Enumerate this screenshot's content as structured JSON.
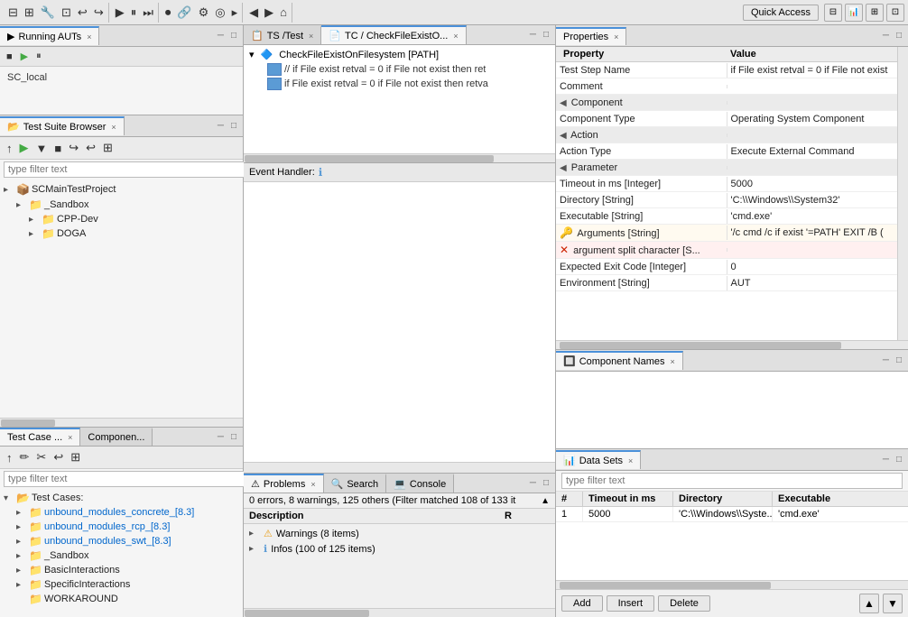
{
  "toolbar": {
    "quick_access_label": "Quick Access",
    "icons": [
      "⬛",
      "⬛",
      "⬛",
      "⬛"
    ]
  },
  "running_auts": {
    "tab_label": "Running AUTs",
    "sc_item": "SC_local",
    "run_icon": "▶",
    "min_btn": "─",
    "max_btn": "□"
  },
  "test_suite_browser": {
    "tab_label": "Test Suite Browser",
    "close_icon": "×",
    "filter_placeholder": "type filter text",
    "toolbar_icons": [
      "↑",
      "▶",
      "▼",
      "■",
      "↪",
      "↩"
    ],
    "tree": {
      "root": {
        "label": "SCMainTestProject",
        "icon": "📁",
        "children": [
          {
            "label": "_Sandbox",
            "icon": "📁",
            "children": [
              {
                "label": "CPP-Dev",
                "icon": "📁",
                "children": []
              },
              {
                "label": "DOGA",
                "icon": "📁",
                "children": []
              }
            ]
          }
        ]
      }
    }
  },
  "test_case_panel": {
    "tab1_label": "Test Case ...",
    "tab1_close": "×",
    "tab2_label": "Componen...",
    "filter_placeholder": "type filter text",
    "toolbar_icons": [
      "↑",
      "✏",
      "✂",
      "↩"
    ],
    "tree_items": [
      {
        "label": "Test Cases:",
        "icon": "📁",
        "type": "root"
      },
      {
        "label": "unbound_modules_concrete_[8.3]",
        "icon": "📁",
        "type": "folder",
        "indent": 1
      },
      {
        "label": "unbound_modules_rcp_[8.3]",
        "icon": "📁",
        "type": "folder",
        "indent": 1
      },
      {
        "label": "unbound_modules_swt_[8.3]",
        "icon": "📁",
        "type": "folder",
        "indent": 1
      },
      {
        "label": "_Sandbox",
        "icon": "📁",
        "type": "folder",
        "indent": 1
      },
      {
        "label": "BasicInteractions",
        "icon": "📁",
        "type": "folder",
        "indent": 1
      },
      {
        "label": "SpecificInteractions",
        "icon": "📁",
        "type": "folder",
        "indent": 1
      },
      {
        "label": "WORKAROUND",
        "icon": "📁",
        "type": "folder",
        "indent": 1
      }
    ]
  },
  "ts_panel": {
    "tab1_label": "TS /Test",
    "tab1_close": "×",
    "tab2_label": "TC / CheckFileExistO...",
    "tab2_close": "×",
    "close_icon": "×",
    "ts_tree": {
      "root_label": "CheckFileExistOnFilesystem [PATH]",
      "root_icon": "🔷",
      "steps": [
        {
          "text": "// if File exist retval = 0 if File not exist then ret",
          "active": true
        },
        {
          "text": "if File exist retval = 0 if File not exist then retva",
          "active": true
        }
      ]
    }
  },
  "event_handler": {
    "label": "Event Handler:",
    "icon": "ℹ"
  },
  "problems_panel": {
    "tab1_label": "Problems",
    "tab1_close": "×",
    "tab2_label": "Search",
    "tab3_label": "Console",
    "filter_text": "0 errors, 8 warnings, 125 others (Filter matched 108 of 133 it",
    "col_description": "Description",
    "col_resource": "R",
    "rows": [
      {
        "icon": "warn",
        "label": "Warnings (8 items)",
        "expand": false
      },
      {
        "icon": "info",
        "label": "Infos (100 of 125 items)",
        "expand": false
      }
    ]
  },
  "properties_panel": {
    "tab_label": "Properties",
    "close_icon": "×",
    "min_btn": "─",
    "max_btn": "□",
    "col_property": "Property",
    "col_value": "Value",
    "rows": [
      {
        "type": "section",
        "name": "Test Step Name",
        "value": "if File exist retval = 0 if File not exist"
      },
      {
        "type": "normal",
        "name": "Comment",
        "value": ""
      },
      {
        "type": "section-header",
        "name": "Component",
        "value": ""
      },
      {
        "type": "normal",
        "name": "Component Type",
        "value": "Operating System Component"
      },
      {
        "type": "section-header",
        "name": "Action",
        "value": ""
      },
      {
        "type": "normal",
        "name": "Action Type",
        "value": "Execute External Command"
      },
      {
        "type": "section-header",
        "name": "Parameter",
        "value": ""
      },
      {
        "type": "normal",
        "name": "Timeout in ms [Integer]",
        "value": "5000"
      },
      {
        "type": "normal",
        "name": "Directory [String]",
        "value": "'C:\\\\Windows\\\\System32'"
      },
      {
        "type": "normal",
        "name": "Executable [String]",
        "value": "'cmd.exe'"
      },
      {
        "type": "special",
        "name": "Arguments [String]",
        "value": "'/c cmd /c if exist '=PATH' EXIT /B (",
        "icon": "arg"
      },
      {
        "type": "err",
        "name": "argument split character [S...",
        "value": "",
        "icon": "err"
      },
      {
        "type": "normal",
        "name": "Expected Exit Code [Integer]",
        "value": "0"
      },
      {
        "type": "normal",
        "name": "Environment [String]",
        "value": "AUT"
      }
    ]
  },
  "component_names": {
    "tab_label": "Component Names",
    "close_icon": "×",
    "min_btn": "─",
    "max_btn": "□"
  },
  "data_sets": {
    "tab_label": "Data Sets",
    "close_icon": "×",
    "min_btn": "─",
    "max_btn": "□",
    "filter_placeholder": "type filter text",
    "columns": [
      "#",
      "Timeout in ms",
      "Directory",
      "Executable"
    ],
    "rows": [
      {
        "num": "1",
        "timeout": "5000",
        "directory": "'C:\\\\Windows\\\\Syste...",
        "executable": "'cmd.exe'"
      }
    ],
    "buttons": {
      "add": "Add",
      "insert": "Insert",
      "delete": "Delete",
      "up": "▲",
      "down": "▼"
    }
  }
}
